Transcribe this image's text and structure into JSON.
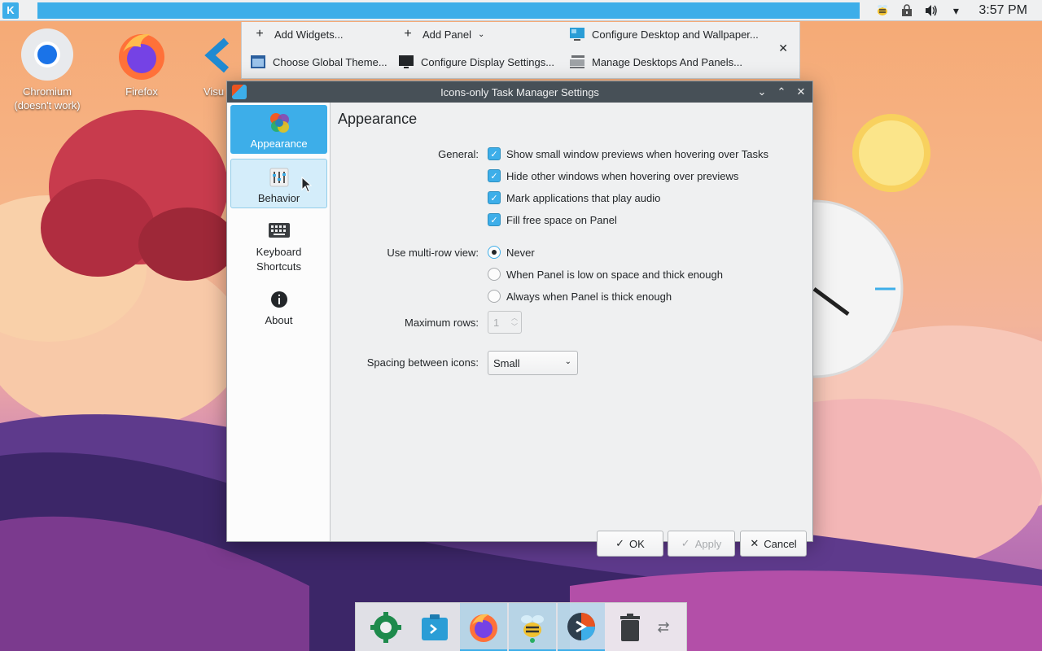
{
  "top_panel": {
    "clock": "3:57 PM"
  },
  "desktop": {
    "icons": [
      {
        "label": "Chromium (doesn't work)",
        "icon": "chromium-icon"
      },
      {
        "label": "Firefox",
        "icon": "firefox-icon"
      },
      {
        "label": "Visu",
        "icon": "vscode-icon"
      }
    ]
  },
  "toolbox": {
    "add_widgets": "Add Widgets...",
    "add_panel": "Add Panel",
    "configure_desktop": "Configure Desktop and Wallpaper...",
    "global_theme": "Choose Global Theme...",
    "display_settings": "Configure Display Settings...",
    "manage_desktops": "Manage Desktops And Panels..."
  },
  "dialog": {
    "title": "Icons-only Task Manager Settings",
    "sidebar": [
      {
        "label": "Appearance",
        "state": "active"
      },
      {
        "label": "Behavior",
        "state": "hover"
      },
      {
        "label": "Keyboard Shortcuts",
        "state": "normal"
      },
      {
        "label": "About",
        "state": "normal"
      }
    ],
    "page_title": "Appearance",
    "general_label": "General:",
    "general_options": [
      {
        "label": "Show small window previews when hovering over Tasks",
        "checked": true
      },
      {
        "label": "Hide other windows when hovering over previews",
        "checked": true
      },
      {
        "label": "Mark applications that play audio",
        "checked": true
      },
      {
        "label": "Fill free space on Panel",
        "checked": true
      }
    ],
    "multirow_label": "Use multi-row view:",
    "multirow_options": [
      {
        "label": "Never",
        "selected": true
      },
      {
        "label": "When Panel is low on space and thick enough",
        "selected": false
      },
      {
        "label": "Always when Panel is thick enough",
        "selected": false
      }
    ],
    "max_rows_label": "Maximum rows:",
    "max_rows_value": "1",
    "spacing_label": "Spacing between icons:",
    "spacing_value": "Small",
    "buttons": {
      "ok": "OK",
      "apply": "Apply",
      "cancel": "Cancel"
    }
  },
  "dock": {
    "items": [
      {
        "icon": "app-store-icon",
        "active": false
      },
      {
        "icon": "dolphin-icon",
        "active": false
      },
      {
        "icon": "firefox-icon",
        "active": true
      },
      {
        "icon": "bee-app-icon",
        "active": true
      },
      {
        "icon": "kde-settings-icon",
        "active": true
      },
      {
        "icon": "trash-icon",
        "active": false
      },
      {
        "icon": "configure-panel-icon",
        "active": false
      }
    ]
  },
  "colors": {
    "accent": "#3daee9",
    "titlebar": "#475057",
    "window_bg": "#eff0f1"
  }
}
